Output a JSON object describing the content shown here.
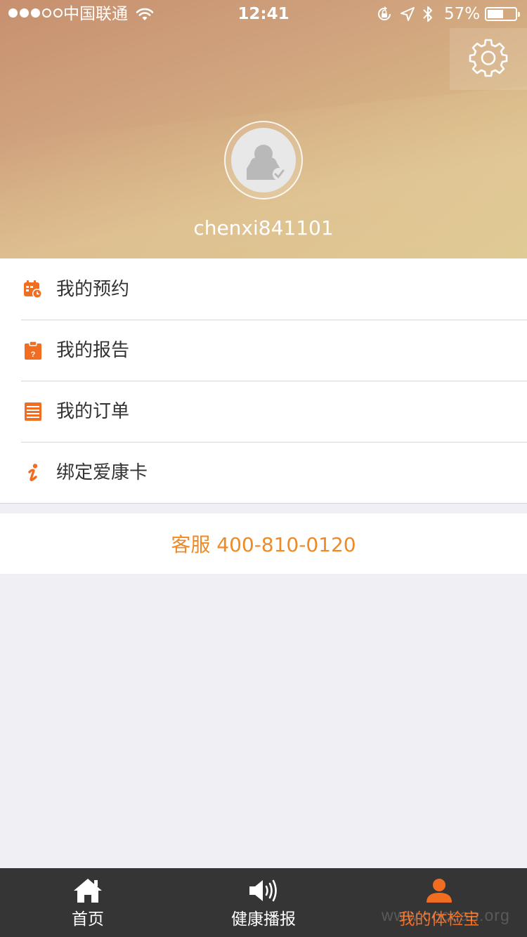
{
  "status_bar": {
    "carrier": "中国联通",
    "time": "12:41",
    "battery_percent_text": "57%",
    "battery_level": 0.57,
    "signal_strength": 3,
    "signal_max": 5
  },
  "header": {
    "settings_icon": "gear-icon",
    "avatar_icon": "user-avatar-placeholder",
    "username": "chenxi841101"
  },
  "menu": {
    "items": [
      {
        "label": "我的预约",
        "icon": "calendar-clock-icon"
      },
      {
        "label": "我的报告",
        "icon": "report-clipboard-icon"
      },
      {
        "label": "我的订单",
        "icon": "order-list-icon"
      },
      {
        "label": "绑定爱康卡",
        "icon": "info-i-icon"
      }
    ]
  },
  "hotline": {
    "text": "客服 400-810-0120"
  },
  "tab_bar": {
    "tabs": [
      {
        "label": "首页",
        "icon": "home-icon",
        "active": false
      },
      {
        "label": "健康播报",
        "icon": "speaker-icon",
        "active": false
      },
      {
        "label": "我的体检宝",
        "icon": "person-icon",
        "active": true
      }
    ]
  },
  "watermark": "www.cocoan.org",
  "colors": {
    "accent": "#f06d22",
    "hotline": "#ef8a24",
    "menu_icon": "#f06d22",
    "tab_bar_bg": "#353535",
    "page_bg": "#efeff4"
  }
}
